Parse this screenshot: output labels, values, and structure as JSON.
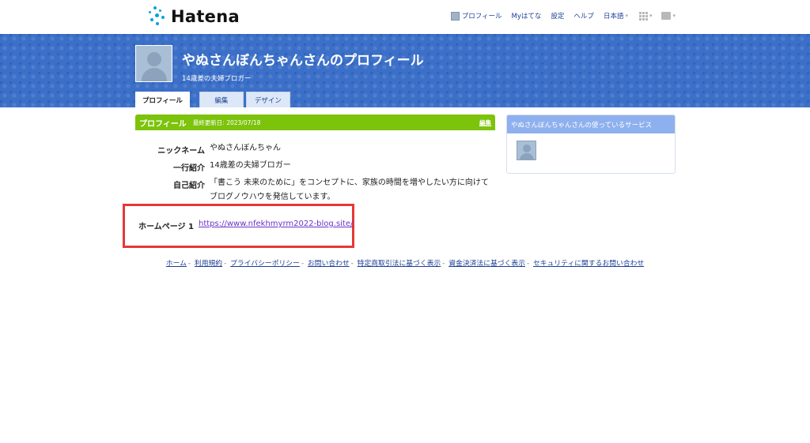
{
  "header": {
    "logo_text": "Hatena",
    "nav": [
      {
        "label": "プロフィール",
        "icon": "user-avatar-icon"
      },
      {
        "label": "Myはてな"
      },
      {
        "label": "設定"
      },
      {
        "label": "ヘルプ"
      },
      {
        "label": "日本語"
      }
    ],
    "icons": [
      "apps-grid-icon",
      "message-icon"
    ]
  },
  "banner": {
    "name": "やぬさんぼんちゃんさんのプロフィール",
    "subtitle": "14歳差の夫婦ブロガー",
    "tabs": [
      {
        "label": "プロフィール",
        "active": true
      },
      {
        "label": "編集",
        "active": false
      },
      {
        "label": "デザイン",
        "active": false
      }
    ]
  },
  "profile": {
    "section_title": "プロフィール",
    "last_updated": "最終更新日: 2023/07/18",
    "edit_label": "編集",
    "nickname_label": "ニックネーム",
    "nickname": "やぬさんぼんちゃん",
    "tagline_label": "一行紹介",
    "tagline": "14歳差の夫婦ブロガー",
    "bio_label": "自己紹介",
    "bio_line1": "「書こう 未来のために」をコンセプトに、家族の時間を増やしたい方に向けて",
    "bio_line2": "ブログノウハウを発信しています。",
    "homepage_label": "ホームページ 1",
    "homepage_url": "https://www.nfekhmyrm2022-blog.site/"
  },
  "sidebar": {
    "title": "やぬさんぼんちゃんさんの使っているサービス"
  },
  "footer": {
    "links": [
      "ホーム",
      "利用規約",
      "プライバシーポリシー",
      "お問い合わせ",
      "特定商取引法に基づく表示",
      "資金決済法に基づく表示",
      "セキュリティに関するお問い合わせ"
    ]
  },
  "colors": {
    "banner_blue": "#3c70c8",
    "section_green": "#7cc30b",
    "link_blue": "#1c3f94",
    "visited_purple": "#6b32c8",
    "highlight_red": "#e53935",
    "sidebar_head": "#8fb0ee"
  }
}
